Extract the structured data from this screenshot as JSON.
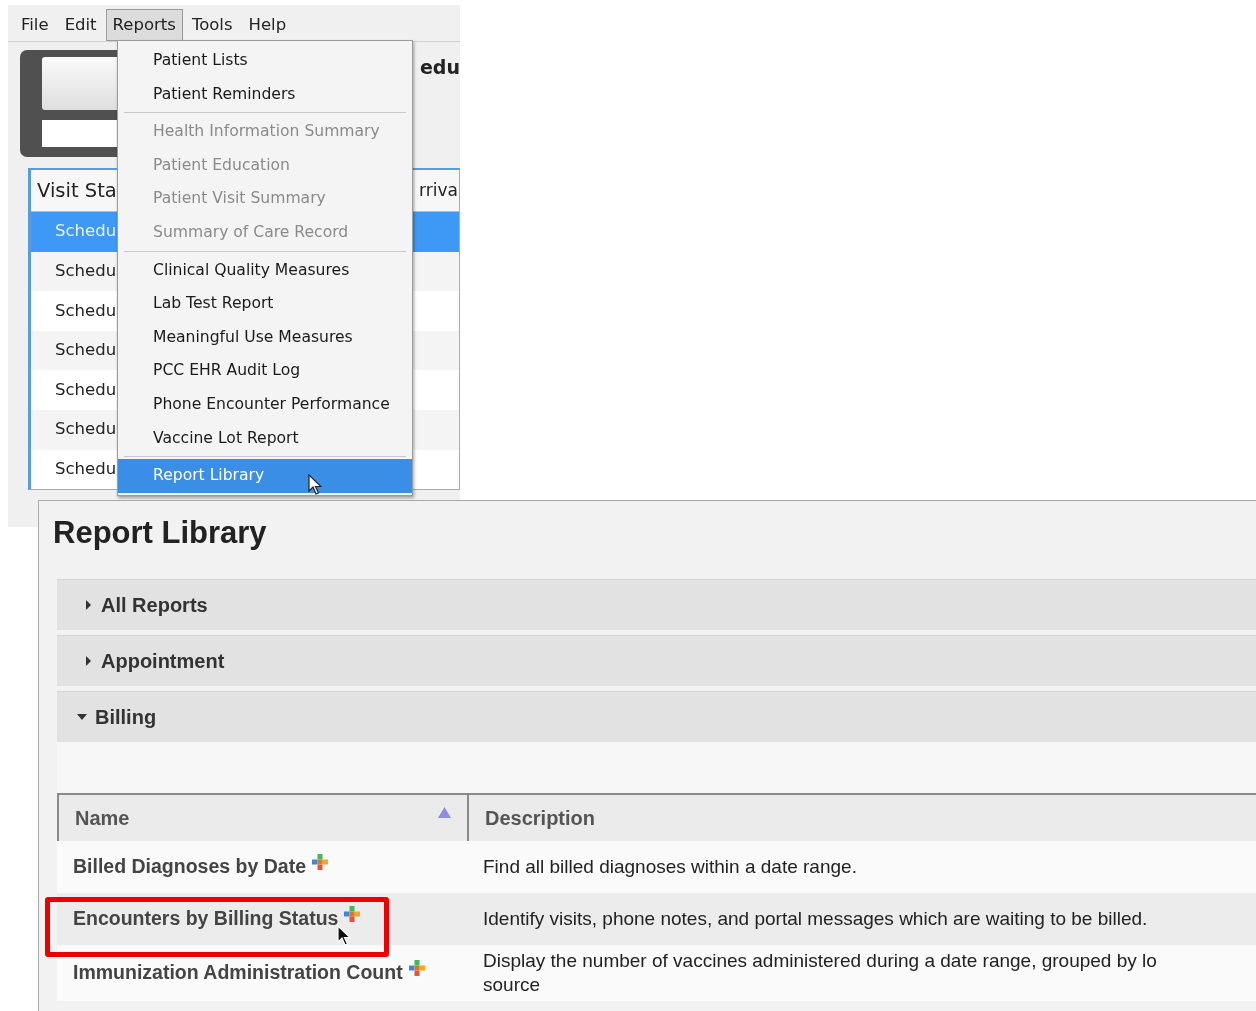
{
  "app_window": {
    "menubar": [
      {
        "label": "File",
        "selected": false
      },
      {
        "label": "Edit",
        "selected": false
      },
      {
        "label": "Reports",
        "selected": true
      },
      {
        "label": "Tools",
        "selected": false
      },
      {
        "label": "Help",
        "selected": false
      }
    ],
    "title_fragment": "edu",
    "table": {
      "columns": [
        "Visit Sta",
        "rriva"
      ],
      "rows": [
        {
          "status": "Schedu",
          "selected": true
        },
        {
          "status": "Schedu",
          "selected": false
        },
        {
          "status": "Schedu",
          "selected": false
        },
        {
          "status": "Schedu",
          "selected": false
        },
        {
          "status": "Schedu",
          "selected": false
        },
        {
          "status": "Schedu",
          "selected": false
        },
        {
          "status": "Schedu",
          "selected": false
        }
      ]
    },
    "reports_menu": {
      "groups": [
        [
          {
            "label": "Patient Lists",
            "disabled": false,
            "selected": false
          },
          {
            "label": "Patient Reminders",
            "disabled": false,
            "selected": false
          }
        ],
        [
          {
            "label": "Health Information Summary",
            "disabled": true,
            "selected": false
          },
          {
            "label": "Patient Education",
            "disabled": true,
            "selected": false
          },
          {
            "label": "Patient Visit Summary",
            "disabled": true,
            "selected": false
          },
          {
            "label": "Summary of Care Record",
            "disabled": true,
            "selected": false
          }
        ],
        [
          {
            "label": "Clinical Quality Measures",
            "disabled": false,
            "selected": false
          },
          {
            "label": "Lab Test Report",
            "disabled": false,
            "selected": false
          },
          {
            "label": "Meaningful Use Measures",
            "disabled": false,
            "selected": false
          },
          {
            "label": "PCC EHR Audit Log",
            "disabled": false,
            "selected": false
          },
          {
            "label": "Phone Encounter Performance",
            "disabled": false,
            "selected": false
          },
          {
            "label": "Vaccine Lot Report",
            "disabled": false,
            "selected": false
          }
        ],
        [
          {
            "label": "Report Library",
            "disabled": false,
            "selected": true
          }
        ]
      ]
    }
  },
  "report_library": {
    "title": "Report Library",
    "sections": [
      {
        "label": "All Reports",
        "expanded": false
      },
      {
        "label": "Appointment",
        "expanded": false
      },
      {
        "label": "Billing",
        "expanded": true
      }
    ],
    "table": {
      "columns": [
        {
          "label": "Name",
          "sorted": true
        },
        {
          "label": "Description",
          "sorted": false
        }
      ],
      "rows": [
        {
          "name": "Billed Diagnoses by Date",
          "description_lines": [
            "Find all billed diagnoses within a date range."
          ],
          "highlighted": false
        },
        {
          "name": "Encounters by Billing Status",
          "description_lines": [
            "Identify visits, phone notes, and portal messages which are waiting to be billed."
          ],
          "highlighted": true
        },
        {
          "name": "Immunization Administration Count",
          "description_lines": [
            "Display the number of vaccines administered during a date range, grouped by lo",
            "source"
          ],
          "highlighted": false
        }
      ]
    }
  }
}
